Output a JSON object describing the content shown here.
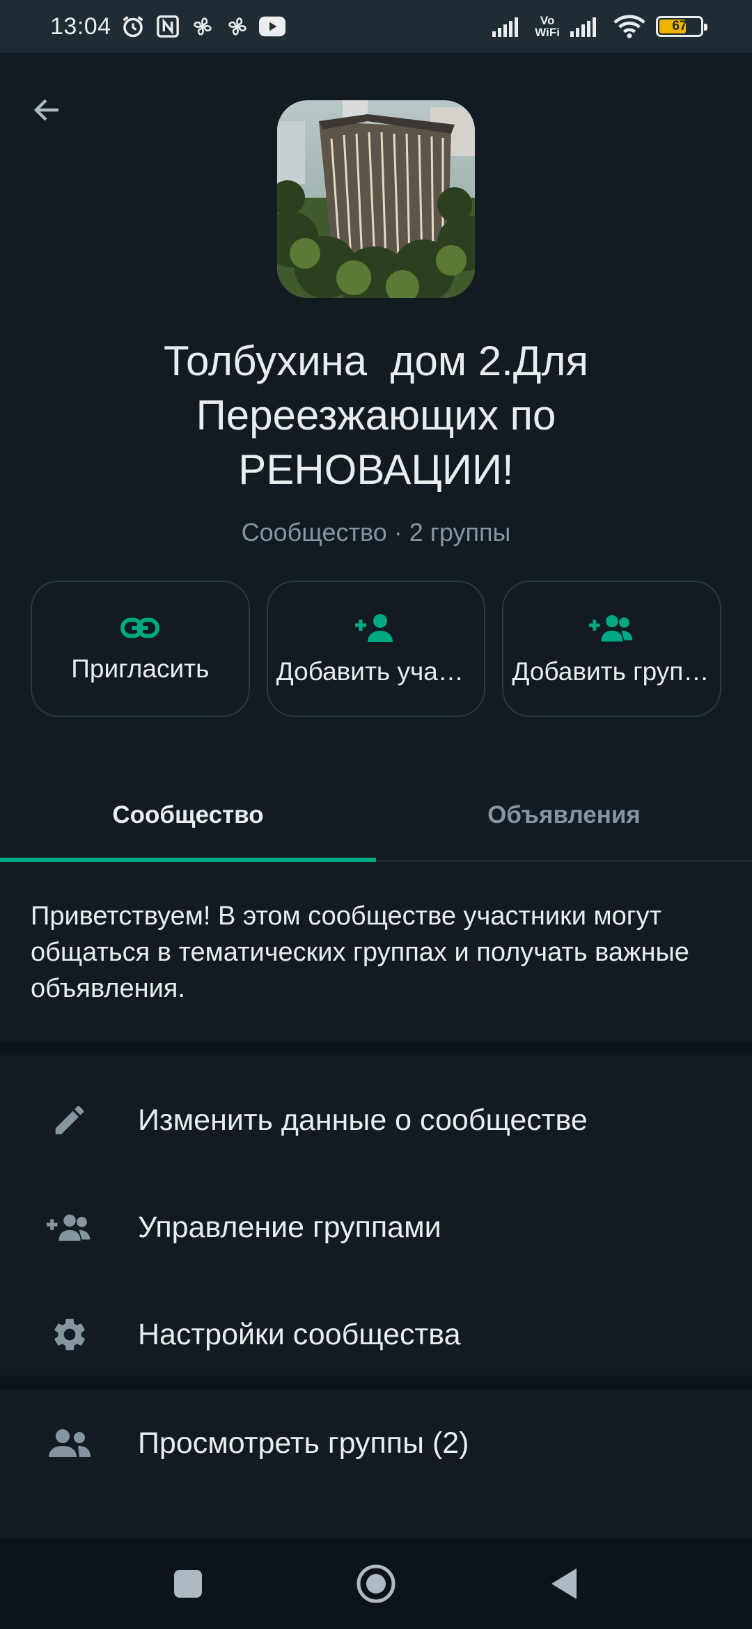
{
  "status_bar": {
    "time": "13:04",
    "vo_wifi_top": "Vo",
    "vo_wifi_bottom": "WiFi",
    "battery": "67",
    "battery_level": 0.67,
    "icons": [
      "alarm-icon",
      "nfc-icon",
      "fan-icon",
      "fan-icon",
      "youtube-icon",
      "signal-icon",
      "vowifi-icon",
      "signal-icon",
      "wifi-icon",
      "battery-icon"
    ]
  },
  "header": {
    "title": "Толбухина  дом 2.Для Переезжающих по РЕНОВАЦИИ!",
    "subtitle": "Сообщество · 2 группы"
  },
  "actions": [
    {
      "label": "Пригласить",
      "icon": "link-icon"
    },
    {
      "label": "Добавить участников",
      "icon": "add-person-icon"
    },
    {
      "label": "Добавить группы",
      "icon": "add-group-icon"
    }
  ],
  "tabs": [
    {
      "label": "Сообщество",
      "active": true
    },
    {
      "label": "Объявления",
      "active": false
    }
  ],
  "description": "Приветствуем! В этом сообществе участники могут общаться в тематических группах и получать важные объявления.",
  "menu": [
    {
      "label": "Изменить данные о сообществе",
      "icon": "edit-icon"
    },
    {
      "label": "Управление группами",
      "icon": "manage-groups-icon"
    },
    {
      "label": "Настройки сообщества",
      "icon": "settings-icon"
    }
  ],
  "view_groups": {
    "label": "Просмотреть группы  (2)",
    "icon": "groups-icon"
  },
  "colors": {
    "accent": "#00a884",
    "background": "#111b21",
    "text": "#e9edef",
    "muted": "#8696a0"
  }
}
